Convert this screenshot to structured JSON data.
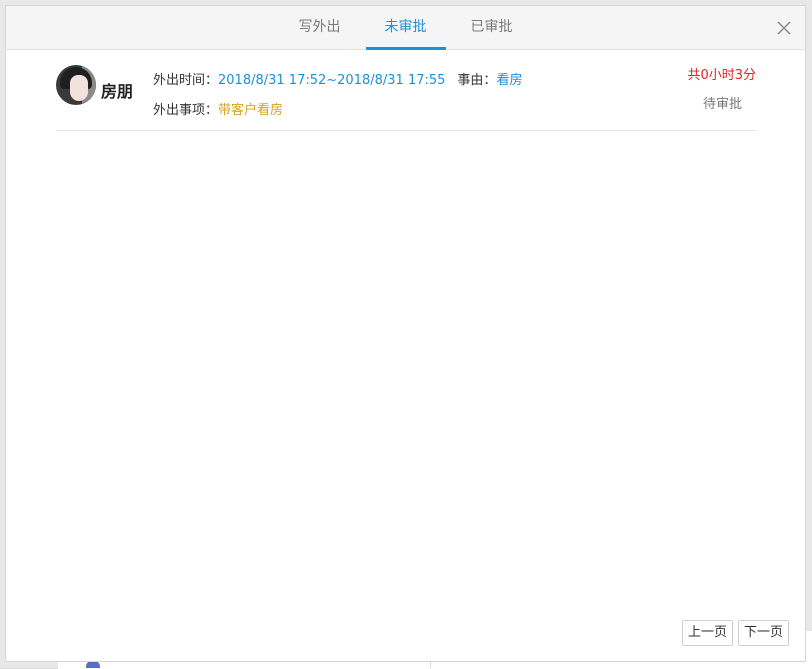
{
  "tabs": [
    {
      "label": "写外出",
      "active": false
    },
    {
      "label": "未审批",
      "active": true
    },
    {
      "label": "已审批",
      "active": false
    }
  ],
  "record": {
    "user_name": "房朋",
    "time_label": "外出时间：",
    "time_value": "2018/8/31 17:52~2018/8/31 17:55",
    "reason_label": "事由：",
    "reason_value": "看房",
    "matter_label": "外出事项：",
    "matter_value": "带客户看房",
    "duration": "共0小时3分",
    "status": "待审批"
  },
  "pager": {
    "prev_label": "上一页",
    "next_label": "下一页"
  },
  "icons": {
    "close": "close-icon",
    "avatar": "user-avatar"
  },
  "colors": {
    "accent": "#1e90d6",
    "matter": "#d9a21c",
    "duration": "#e02424",
    "status": "#777777"
  }
}
